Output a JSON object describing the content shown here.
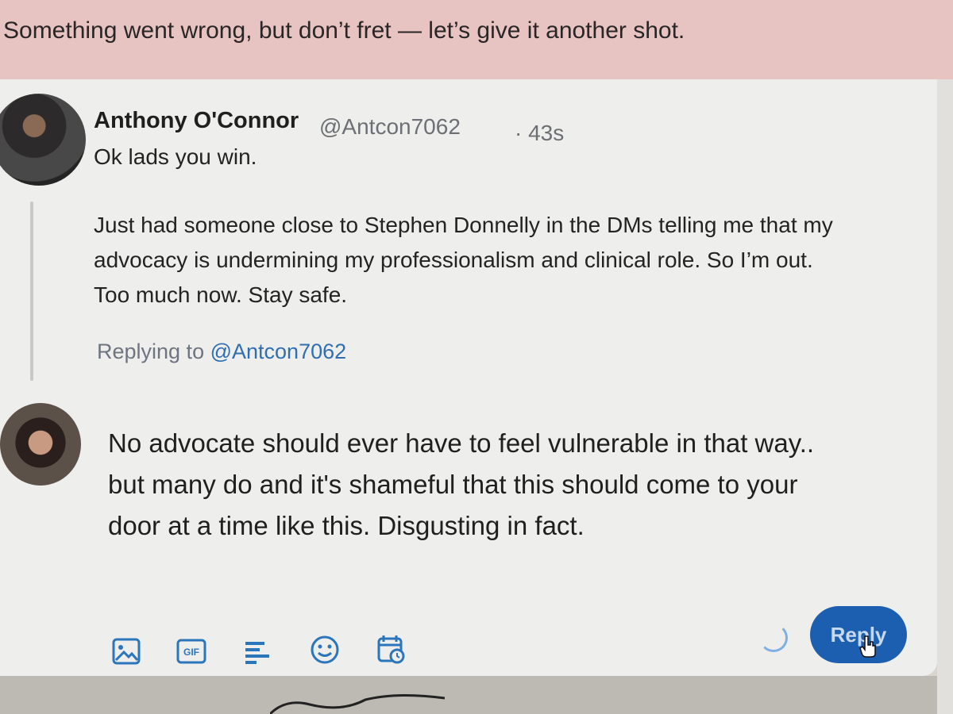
{
  "error": {
    "message": "Something went wrong, but don’t fret — let’s give it another shot."
  },
  "tweet": {
    "name": "Anthony O'Connor",
    "handle": "@Antcon7062",
    "time": "· 43s",
    "lines": [
      "Ok lads you win.",
      "Just had someone close to Stephen Donnelly in the DMs telling me that my",
      "advocacy is undermining my professionalism and clinical role. So I’m out.",
      "Too much now. Stay safe."
    ]
  },
  "replying": {
    "prefix": "Replying to",
    "handle": "@Antcon7062"
  },
  "reply": {
    "lines": [
      "No advocate should ever have to feel vulnerable in that way..",
      "but many do and it's shameful that this should come to your",
      "door at a time like this. Disgusting in fact."
    ],
    "button_label": "Reply"
  },
  "toolbar": {
    "icons": [
      "image-icon",
      "gif-icon",
      "poll-icon",
      "emoji-icon",
      "schedule-icon"
    ],
    "gif_label": "GIF"
  },
  "colors": {
    "error_bg": "#e7c3c2",
    "accent": "#1c5fb0",
    "link": "#2f6eb1"
  }
}
